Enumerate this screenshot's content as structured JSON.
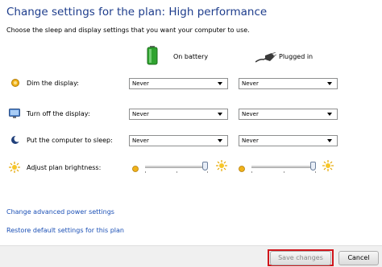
{
  "header": {
    "title": "Change settings for the plan: High performance",
    "subtitle": "Choose the sleep and display settings that you want your computer to use."
  },
  "columns": {
    "battery": "On battery",
    "plugged": "Plugged in"
  },
  "rows": [
    {
      "label": "Dim the display:",
      "battery": "Never",
      "plugged": "Never"
    },
    {
      "label": "Turn off the display:",
      "battery": "Never",
      "plugged": "Never"
    },
    {
      "label": "Put the computer to sleep:",
      "battery": "Never",
      "plugged": "Never"
    }
  ],
  "brightness": {
    "label": "Adjust plan brightness:",
    "battery_level": 1.0,
    "plugged_level": 1.0
  },
  "links": {
    "advanced": "Change advanced power settings",
    "restore": "Restore default settings for this plan"
  },
  "footer": {
    "save": "Save changes",
    "cancel": "Cancel"
  },
  "colors": {
    "title": "#1e3d8c",
    "link": "#1a4fb5",
    "highlight": "#d0161c"
  }
}
